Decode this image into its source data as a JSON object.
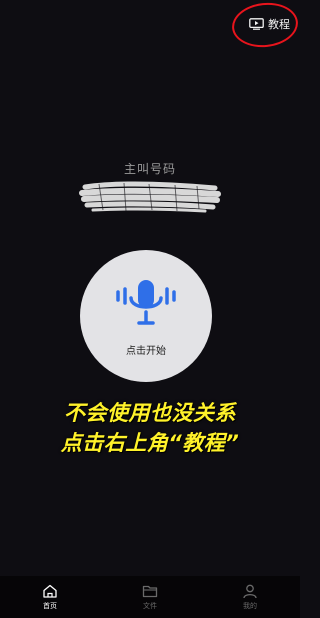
{
  "header": {
    "tutorial_label": "教程",
    "tutorial_icon": "play-screen-icon",
    "annotation_color": "#e8141c"
  },
  "main": {
    "caller_label": "主叫号码",
    "mic_icon": "microphone-icon",
    "start_label": "点击开始",
    "accent_color": "#2f6fe8"
  },
  "caption": {
    "line1": "不会使用也没关系",
    "line2": "点击右上角“教程”",
    "color": "#fff22a"
  },
  "nav": {
    "items": [
      {
        "label": "首页",
        "icon": "home-icon",
        "active": true
      },
      {
        "label": "文件",
        "icon": "folder-icon",
        "active": false
      },
      {
        "label": "我的",
        "icon": "user-icon",
        "active": false
      }
    ]
  }
}
